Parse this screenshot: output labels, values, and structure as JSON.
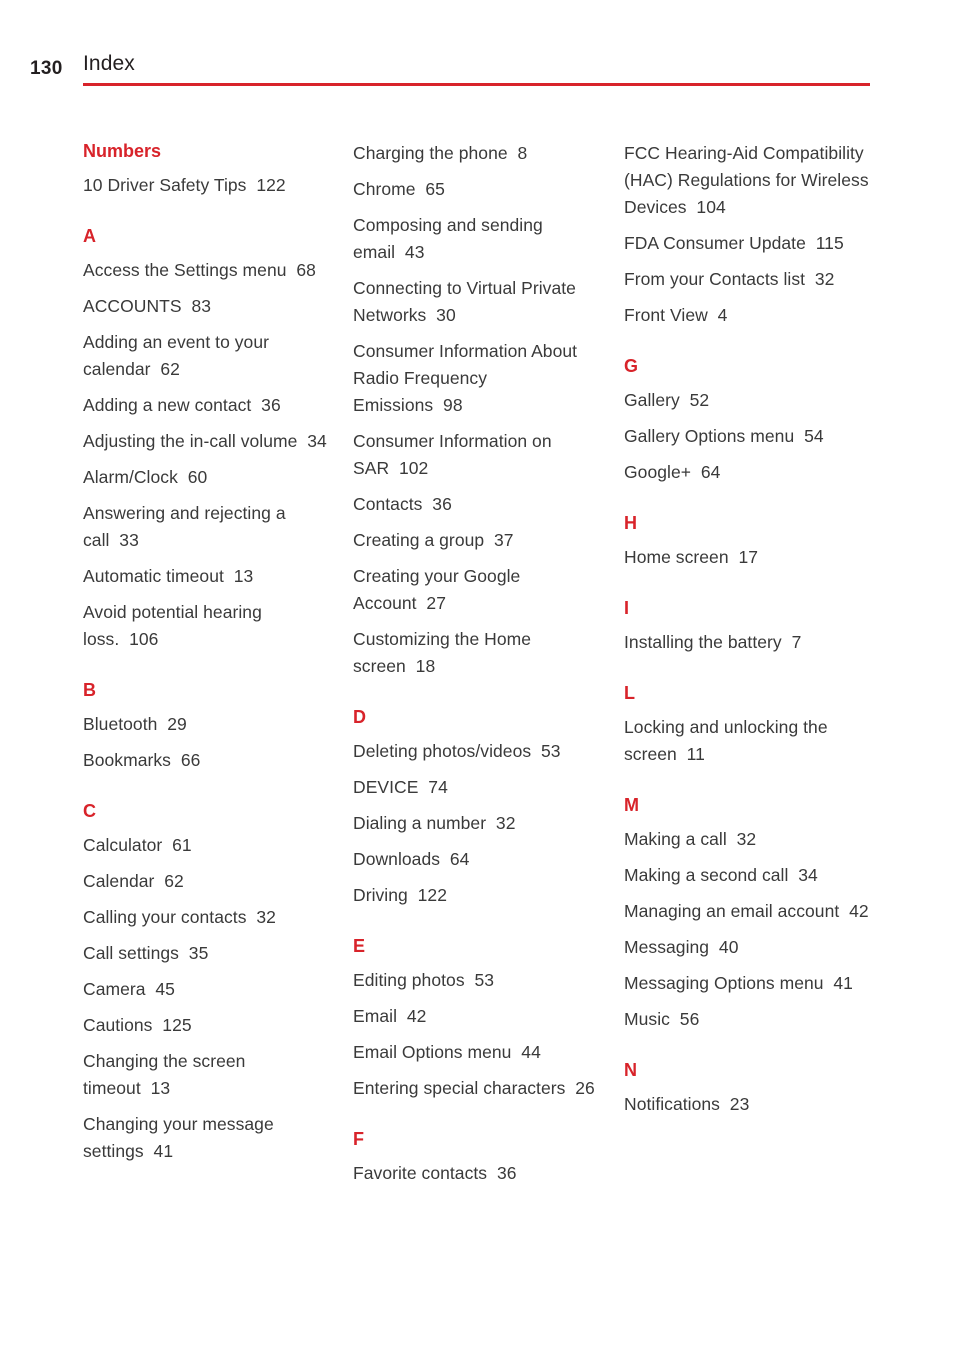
{
  "header": {
    "page_number": "130",
    "title": "Index",
    "rule_color": "#d8232a"
  },
  "colors": {
    "accent_red": "#d8232a",
    "body_text": "#3a3a3a",
    "header_text": "#231f20"
  },
  "columns": [
    {
      "name": "column-1",
      "sections": [
        {
          "letter": "Numbers",
          "entries": [
            {
              "title": "10 Driver Safety Tips",
              "page": "122"
            }
          ]
        },
        {
          "letter": "A",
          "entries": [
            {
              "title": "Access the Settings menu",
              "page": "68"
            },
            {
              "title": "ACCOUNTS",
              "page": "83"
            },
            {
              "title": "Adding an event to your calendar",
              "page": "62"
            },
            {
              "title": "Adding a new contact",
              "page": "36"
            },
            {
              "title": "Adjusting the in-call volume",
              "page": "34"
            },
            {
              "title": "Alarm/Clock",
              "page": "60"
            },
            {
              "title": "Answering and rejecting a call",
              "page": "33"
            },
            {
              "title": "Automatic timeout",
              "page": "13"
            },
            {
              "title": "Avoid potential hearing loss.",
              "page": "106"
            }
          ]
        },
        {
          "letter": "B",
          "entries": [
            {
              "title": "Bluetooth",
              "page": "29"
            },
            {
              "title": "Bookmarks",
              "page": "66"
            }
          ]
        },
        {
          "letter": "C",
          "entries": [
            {
              "title": "Calculator",
              "page": "61"
            },
            {
              "title": "Calendar",
              "page": "62"
            },
            {
              "title": "Calling your contacts",
              "page": "32"
            },
            {
              "title": "Call settings",
              "page": "35"
            },
            {
              "title": "Camera",
              "page": "45"
            },
            {
              "title": "Cautions",
              "page": "125"
            },
            {
              "title": "Changing the screen timeout",
              "page": "13"
            },
            {
              "title": "Changing your message settings",
              "page": "41"
            }
          ]
        }
      ]
    },
    {
      "name": "column-2",
      "sections": [
        {
          "letter": "",
          "entries": [
            {
              "title": "Charging the phone",
              "page": "8"
            },
            {
              "title": "Chrome",
              "page": "65"
            },
            {
              "title": "Composing and sending email",
              "page": "43"
            },
            {
              "title": "Connecting to Virtual Private Networks",
              "page": "30"
            },
            {
              "title": "Consumer Information About Radio Frequency Emissions",
              "page": "98"
            },
            {
              "title": "Consumer Information on SAR",
              "page": "102"
            },
            {
              "title": "Contacts",
              "page": "36"
            },
            {
              "title": "Creating a group",
              "page": "37"
            },
            {
              "title": "Creating your Google Account",
              "page": "27"
            },
            {
              "title": "Customizing the Home screen",
              "page": "18"
            }
          ]
        },
        {
          "letter": "D",
          "entries": [
            {
              "title": "Deleting photos/videos",
              "page": "53"
            },
            {
              "title": "DEVICE",
              "page": "74"
            },
            {
              "title": "Dialing a number",
              "page": "32"
            },
            {
              "title": "Downloads",
              "page": "64"
            },
            {
              "title": "Driving",
              "page": "122"
            }
          ]
        },
        {
          "letter": "E",
          "entries": [
            {
              "title": "Editing photos",
              "page": "53"
            },
            {
              "title": "Email",
              "page": "42"
            },
            {
              "title": "Email Options menu",
              "page": "44"
            },
            {
              "title": "Entering special characters",
              "page": "26"
            }
          ]
        },
        {
          "letter": "F",
          "entries": [
            {
              "title": "Favorite contacts",
              "page": "36"
            }
          ]
        }
      ]
    },
    {
      "name": "column-3",
      "sections": [
        {
          "letter": "",
          "entries": [
            {
              "title": "FCC Hearing-Aid Compatibility (HAC) Regulations for Wireless Devices",
              "page": "104"
            },
            {
              "title": "FDA Consumer Update",
              "page": "115"
            },
            {
              "title": "From your Contacts list",
              "page": "32"
            },
            {
              "title": "Front View",
              "page": "4"
            }
          ]
        },
        {
          "letter": "G",
          "entries": [
            {
              "title": "Gallery",
              "page": "52"
            },
            {
              "title": "Gallery Options menu",
              "page": "54"
            },
            {
              "title": "Google+",
              "page": "64"
            }
          ]
        },
        {
          "letter": "H",
          "entries": [
            {
              "title": "Home screen",
              "page": "17"
            }
          ]
        },
        {
          "letter": "I",
          "entries": [
            {
              "title": "Installing the battery",
              "page": "7"
            }
          ]
        },
        {
          "letter": "L",
          "entries": [
            {
              "title": "Locking and unlocking the screen",
              "page": "11"
            }
          ]
        },
        {
          "letter": "M",
          "entries": [
            {
              "title": "Making a call",
              "page": "32"
            },
            {
              "title": "Making a second call",
              "page": "34"
            },
            {
              "title": "Managing an email account",
              "page": "42"
            },
            {
              "title": "Messaging",
              "page": "40"
            },
            {
              "title": "Messaging Options menu",
              "page": "41"
            },
            {
              "title": "Music",
              "page": "56"
            }
          ]
        },
        {
          "letter": "N",
          "entries": [
            {
              "title": "Notifications",
              "page": "23"
            }
          ]
        }
      ]
    }
  ]
}
